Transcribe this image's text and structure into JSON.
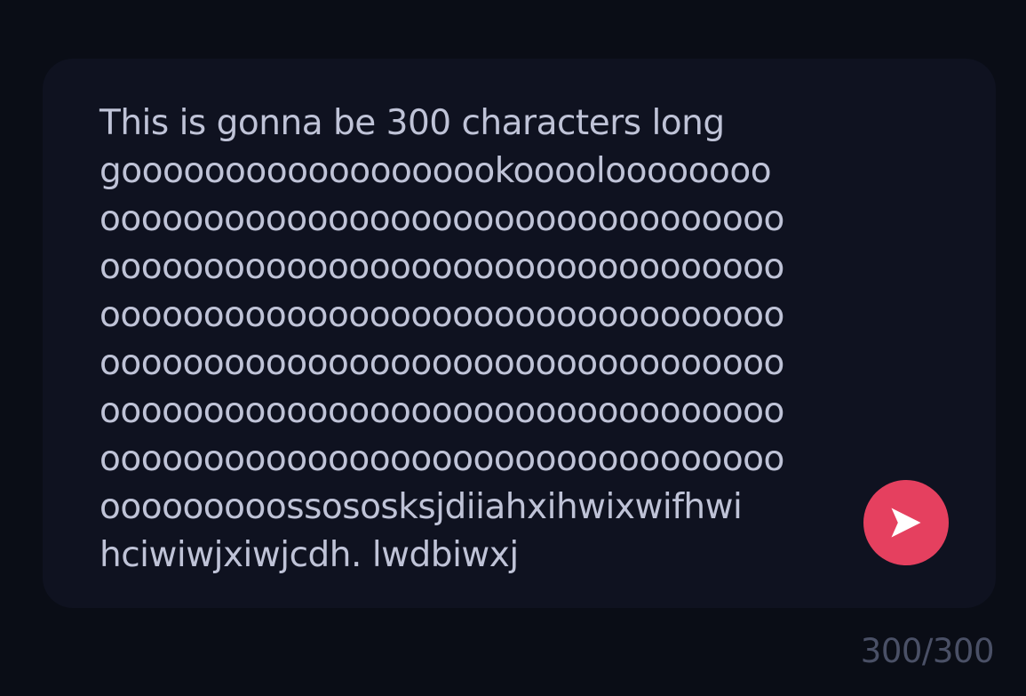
{
  "composer": {
    "message_lines": [
      "This is gonna be 300 characters long",
      "gooooooooooooooooookooooloooooooo",
      "ooooooooooooooooooooooooooooooooo",
      "ooooooooooooooooooooooooooooooooo",
      "ooooooooooooooooooooooooooooooooo",
      "ooooooooooooooooooooooooooooooooo",
      "ooooooooooooooooooooooooooooooooo",
      "ooooooooooooooooooooooooooooooooo",
      "ooooooooossososksjdiiahxihwixwifhwi",
      "hciwiwjxiwjcdh. lwdbiwxj"
    ],
    "send_icon": "send-arrow-icon",
    "character_count": "300/300"
  },
  "colors": {
    "background": "#0a0d16",
    "composer_background": "#0f1220",
    "text": "#bfc3d7",
    "send_button": "#e5405f",
    "counter_text": "#4a5066"
  }
}
